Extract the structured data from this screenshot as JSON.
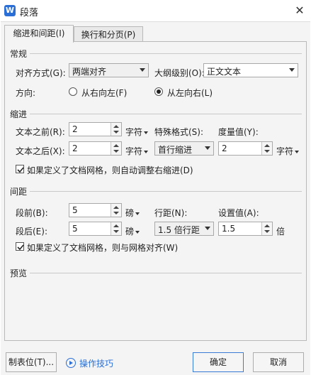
{
  "window": {
    "title": "段落",
    "app_icon_letter": "W"
  },
  "tabs": [
    {
      "label": "缩进和间距(I)"
    },
    {
      "label": "换行和分页(P)"
    }
  ],
  "general": {
    "section": "常规",
    "align_label": "对齐方式(G):",
    "align_value": "两端对齐",
    "outline_label": "大纲级别(O):",
    "outline_value": "正文文本",
    "direction_label": "方向:",
    "rtl_label": "从右向左(F)",
    "ltr_label": "从左向右(L)"
  },
  "indent": {
    "section": "缩进",
    "before_label": "文本之前(R):",
    "before_value": "2",
    "before_unit": "字符",
    "after_label": "文本之后(X):",
    "after_value": "2",
    "after_unit": "字符",
    "special_label": "特殊格式(S):",
    "special_value": "首行缩进",
    "measure_label": "度量值(Y):",
    "measure_value": "2",
    "measure_unit": "字符",
    "grid_check_label": "如果定义了文档网格，则自动调整右缩进(D)"
  },
  "spacing": {
    "section": "间距",
    "before_label": "段前(B):",
    "before_value": "5",
    "before_unit": "磅",
    "after_label": "段后(E):",
    "after_value": "5",
    "after_unit": "磅",
    "line_label": "行距(N):",
    "line_value": "1.5 倍行距",
    "setting_label": "设置值(A):",
    "setting_value": "1.5",
    "setting_unit": "倍",
    "grid_check_label": "如果定义了文档网格，则与网格对齐(W)"
  },
  "preview": {
    "section": "预览"
  },
  "footer": {
    "tabs_button": "制表位(T)...",
    "tips_label": "操作技巧",
    "ok_button": "确定",
    "cancel_button": "取消"
  },
  "colors": {
    "accent": "#2b6fd6",
    "dialog_bg": "#f4f4f4",
    "border": "#b9b9b9"
  }
}
